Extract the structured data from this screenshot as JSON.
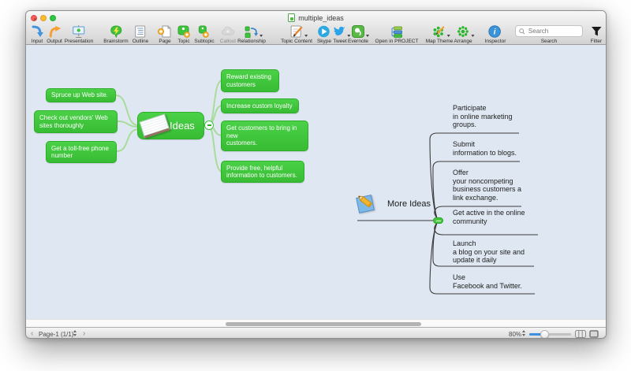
{
  "window_title": "multiple_ideas",
  "toolbar": {
    "items": [
      {
        "label": "Input"
      },
      {
        "label": "Output"
      },
      {
        "label": "Presentation"
      },
      {
        "label": "Brainstorm"
      },
      {
        "label": "Outline"
      },
      {
        "label": "Page"
      },
      {
        "label": "Topic"
      },
      {
        "label": "Subtopic"
      },
      {
        "label": "Callout",
        "disabled": true
      },
      {
        "label": "Relationship"
      },
      {
        "label": "Topic Content"
      },
      {
        "label": "Skype"
      },
      {
        "label": "Tweet"
      },
      {
        "label": "Evernote"
      },
      {
        "label": "Open in PROJECT"
      },
      {
        "label": "Map Theme"
      },
      {
        "label": "Arrange"
      },
      {
        "label": "Inspector"
      }
    ],
    "search": {
      "placeholder": "Search",
      "label": "Search"
    },
    "filter_label": "Filter"
  },
  "map": {
    "central": {
      "label": "Ideas"
    },
    "left_topics": [
      {
        "text": "Spruce up Web site."
      },
      {
        "text": "Check out vendors' Web\nsites thoroughly"
      },
      {
        "text": "Get a toll-free phone\nnumber"
      }
    ],
    "right_topics": [
      {
        "text": "Reward existing\ncustomers"
      },
      {
        "text": "Increase custom loyalty"
      },
      {
        "text": "Get customers to bring in\nnew\ncustomers."
      },
      {
        "text": "Provide free, helpful\ninformation to customers."
      }
    ],
    "more": {
      "label": "More Ideas",
      "topics": [
        {
          "text": "Participate\nin online marketing\ngroups."
        },
        {
          "text": "Submit\ninformation to blogs."
        },
        {
          "text": "Offer\nyour noncompeting\nbusiness customers a\nlink exchange."
        },
        {
          "text": " Get active in the online\ncommunity"
        },
        {
          "text": "Launch\na blog on your site and\nupdate it daily"
        },
        {
          "text": "Use\nFacebook and Twitter."
        }
      ]
    }
  },
  "statusbar": {
    "page": "Page-1 (1/1)",
    "zoom": "80%"
  },
  "colors": {
    "topic_green": "#3ec43e",
    "connector_green": "#a9dc9b",
    "branch_line": "#3c3c3c",
    "canvas_bg": "#dfe8f2",
    "slider_blue": "#3f8fe0"
  }
}
